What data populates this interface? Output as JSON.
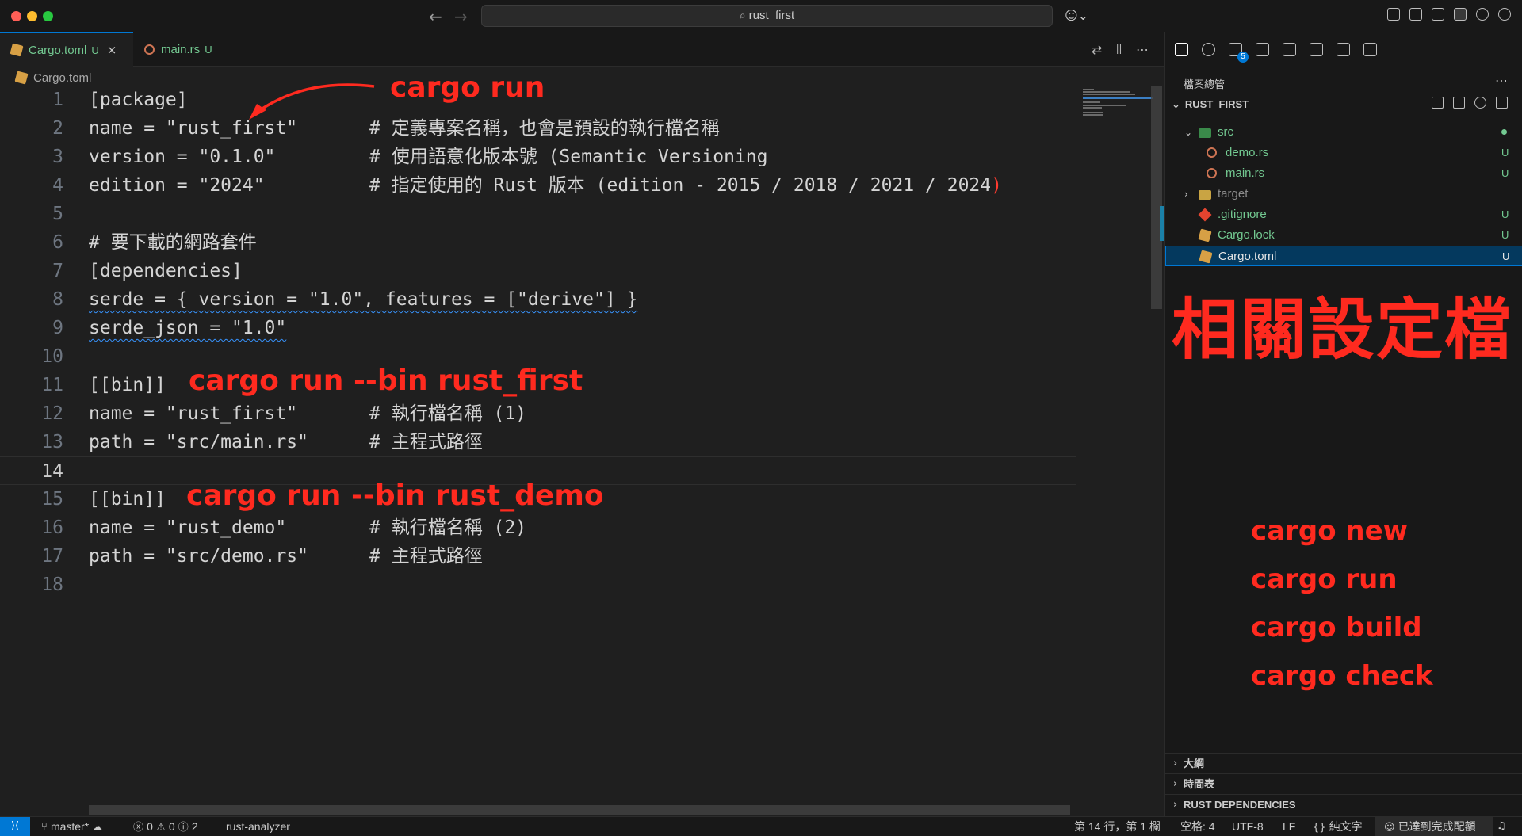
{
  "window": {
    "search_text": "rust_first",
    "nav_back": "←",
    "nav_forward": "→",
    "copilot_glyph": "☺⌄"
  },
  "tabs": [
    {
      "label": "Cargo.toml",
      "status": "U",
      "active": true
    },
    {
      "label": "main.rs",
      "status": "U",
      "active": false
    }
  ],
  "tab_actions": [
    "⇄",
    "⫴",
    "⋯"
  ],
  "breadcrumb": {
    "file": "Cargo.toml"
  },
  "editor": {
    "current_line": 14,
    "lines": [
      {
        "n": "1",
        "code": "[package]",
        "comment": ""
      },
      {
        "n": "2",
        "code": "name = \"rust_first\"",
        "comment": "# 定義專案名稱，也會是預設的執行檔名稱"
      },
      {
        "n": "3",
        "code": "version = \"0.1.0\"",
        "comment": "# 使用語意化版本號 (Semantic Versioning"
      },
      {
        "n": "4",
        "code": "edition = \"2024\"",
        "comment": "# 指定使用的 Rust 版本 (edition - 2015 / 2018 / 2021 / 2024"
      },
      {
        "n": "5",
        "code": "",
        "comment": ""
      },
      {
        "n": "6",
        "code": "# 要下載的網路套件",
        "comment": ""
      },
      {
        "n": "7",
        "code": "[dependencies]",
        "comment": ""
      },
      {
        "n": "8",
        "code": "serde = { version = \"1.0\", features = [\"derive\"] }",
        "comment": ""
      },
      {
        "n": "9",
        "code": "serde_json = \"1.0\"",
        "comment": ""
      },
      {
        "n": "10",
        "code": "",
        "comment": ""
      },
      {
        "n": "11",
        "code": "[[bin]]",
        "comment": ""
      },
      {
        "n": "12",
        "code": "name = \"rust_first\"",
        "comment": "# 執行檔名稱 (1)"
      },
      {
        "n": "13",
        "code": "path = \"src/main.rs\"",
        "comment": "# 主程式路徑"
      },
      {
        "n": "14",
        "code": "",
        "comment": ""
      },
      {
        "n": "15",
        "code": "[[bin]]",
        "comment": ""
      },
      {
        "n": "16",
        "code": "name = \"rust_demo\"",
        "comment": "# 執行檔名稱 (2)"
      },
      {
        "n": "17",
        "code": "path = \"src/demo.rs\"",
        "comment": "# 主程式路徑"
      },
      {
        "n": "18",
        "code": "",
        "comment": ""
      }
    ],
    "line4_close_paren": ")"
  },
  "annotations": {
    "cargo_run": "cargo run",
    "bin_first": "cargo run --bin rust_first",
    "bin_demo": "cargo run --bin rust_demo",
    "config_files": "相關設定檔",
    "commands": [
      "cargo new",
      "cargo run",
      "cargo build",
      "cargo check"
    ],
    "color": "#ff2a1f"
  },
  "explorer": {
    "title": "檔案總管",
    "more": "⋯",
    "root": "RUST_FIRST",
    "items": [
      {
        "label": "src",
        "status": "",
        "kind": "folder-open"
      },
      {
        "label": "demo.rs",
        "status": "U",
        "kind": "rust"
      },
      {
        "label": "main.rs",
        "status": "U",
        "kind": "rust"
      },
      {
        "label": "target",
        "status": "",
        "kind": "folder"
      },
      {
        "label": ".gitignore",
        "status": "U",
        "kind": "git"
      },
      {
        "label": "Cargo.lock",
        "status": "U",
        "kind": "cargo"
      },
      {
        "label": "Cargo.toml",
        "status": "U",
        "kind": "cargo"
      }
    ],
    "sections": [
      "大綱",
      "時間表",
      "RUST DEPENDENCIES"
    ],
    "scm_badge": "5"
  },
  "statusbar": {
    "remote": "⟩⟨",
    "branch": "master*",
    "errors": "0",
    "warnings": "0",
    "infos": "2",
    "analyzer": "rust-analyzer",
    "position": "第 14 行，第 1 欄",
    "spaces": "空格: 4",
    "encoding": "UTF-8",
    "eol": "LF",
    "language": "純文字",
    "copilot": "已達到完成配額"
  },
  "colors": {
    "accent": "#0078d4",
    "untracked": "#73c991"
  }
}
